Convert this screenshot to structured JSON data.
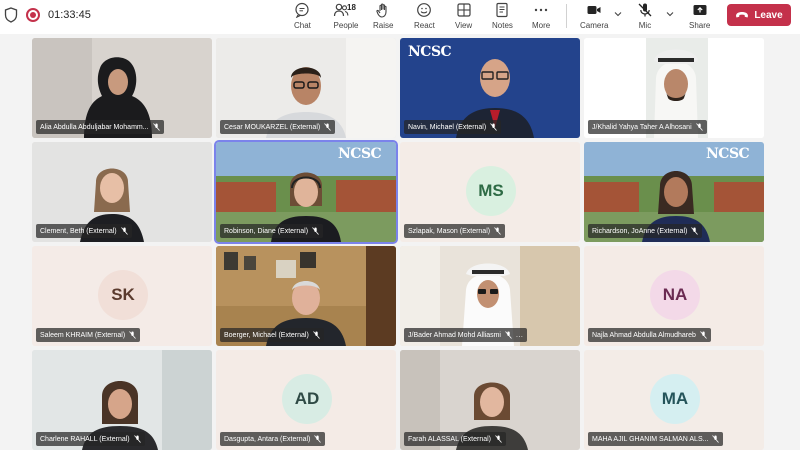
{
  "meeting": {
    "timer": "01:33:45"
  },
  "toolbar": {
    "chat": "Chat",
    "people": "People",
    "people_count": "18",
    "raise": "Raise",
    "react": "React",
    "view": "View",
    "notes": "Notes",
    "more": "More",
    "camera": "Camera",
    "mic": "Mic",
    "share": "Share",
    "leave": "Leave"
  },
  "colors": {
    "leave_button": "#c4314b",
    "active_speaker_border": "#7b83eb",
    "nametag_bg": "#262626"
  },
  "participants": [
    {
      "name": "Alia Abdulla Abduljabar Mohamm...",
      "video": true,
      "muted": true
    },
    {
      "name": "Cesar MOUKARZEL (External)",
      "video": true,
      "muted": true
    },
    {
      "name": "Navin, Michael (External)",
      "video": true,
      "muted": true,
      "background_logo": "NCSC"
    },
    {
      "name": "J/Khalid Yahya Taher A Alhosani",
      "video": true,
      "muted": true
    },
    {
      "name": "Clement, Beth (External)",
      "video": true,
      "muted": true
    },
    {
      "name": "Robinson, Diane (External)",
      "video": true,
      "muted": true,
      "active_speaker": true,
      "background_logo": "NCSC"
    },
    {
      "name": "Szlapak, Mason (External)",
      "video": false,
      "initials": "MS",
      "muted": true
    },
    {
      "name": "Richardson, JoAnne (External)",
      "video": true,
      "muted": true,
      "background_logo": "NCSC"
    },
    {
      "name": "Saleem KHRAIM (External)",
      "video": false,
      "initials": "SK",
      "muted": true
    },
    {
      "name": "Boerger, Michael (External)",
      "video": true,
      "muted": true
    },
    {
      "name": "J/Bader Ahmad Mohd Alliasmi",
      "video": true,
      "muted": true,
      "more_options": "..."
    },
    {
      "name": "Najla Ahmad Abdulla Almudhareb",
      "video": false,
      "initials": "NA",
      "muted": true
    },
    {
      "name": "Charlene RAHALL (External)",
      "video": true,
      "muted": true
    },
    {
      "name": "Dasgupta, Antara (External)",
      "video": false,
      "initials": "AD",
      "muted": true
    },
    {
      "name": "Farah ALASSAL (External)",
      "video": true,
      "muted": true
    },
    {
      "name": "MAHA AJIL GHANIM SALMAN ALS...",
      "video": false,
      "initials": "MA",
      "muted": true
    }
  ]
}
